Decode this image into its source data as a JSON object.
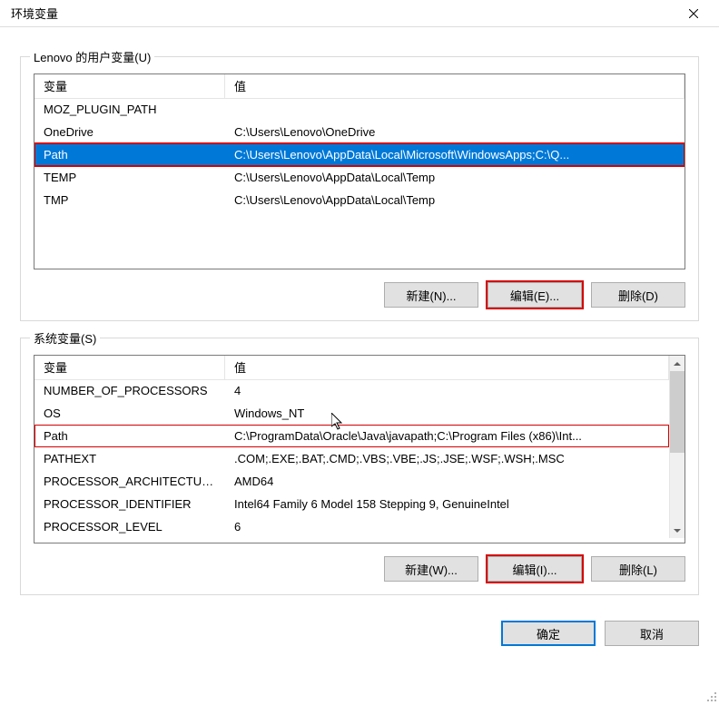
{
  "title": "环境变量",
  "userGroup": {
    "label": "Lenovo 的用户变量(U)",
    "headers": {
      "var": "变量",
      "val": "值"
    },
    "rows": [
      {
        "var": "MOZ_PLUGIN_PATH",
        "val": ""
      },
      {
        "var": "OneDrive",
        "val": "C:\\Users\\Lenovo\\OneDrive"
      },
      {
        "var": "Path",
        "val": "C:\\Users\\Lenovo\\AppData\\Local\\Microsoft\\WindowsApps;C:\\Q..."
      },
      {
        "var": "TEMP",
        "val": "C:\\Users\\Lenovo\\AppData\\Local\\Temp"
      },
      {
        "var": "TMP",
        "val": "C:\\Users\\Lenovo\\AppData\\Local\\Temp"
      }
    ],
    "buttons": {
      "new": "新建(N)...",
      "edit": "编辑(E)...",
      "del": "删除(D)"
    }
  },
  "sysGroup": {
    "label": "系统变量(S)",
    "headers": {
      "var": "变量",
      "val": "值"
    },
    "rows": [
      {
        "var": "NUMBER_OF_PROCESSORS",
        "val": "4"
      },
      {
        "var": "OS",
        "val": "Windows_NT"
      },
      {
        "var": "Path",
        "val": "C:\\ProgramData\\Oracle\\Java\\javapath;C:\\Program Files (x86)\\Int..."
      },
      {
        "var": "PATHEXT",
        "val": ".COM;.EXE;.BAT;.CMD;.VBS;.VBE;.JS;.JSE;.WSF;.WSH;.MSC"
      },
      {
        "var": "PROCESSOR_ARCHITECTURE",
        "val": "AMD64"
      },
      {
        "var": "PROCESSOR_IDENTIFIER",
        "val": "Intel64 Family 6 Model 158 Stepping 9, GenuineIntel"
      },
      {
        "var": "PROCESSOR_LEVEL",
        "val": "6"
      }
    ],
    "buttons": {
      "new": "新建(W)...",
      "edit": "编辑(I)...",
      "del": "删除(L)"
    }
  },
  "footer": {
    "ok": "确定",
    "cancel": "取消"
  },
  "highlight": {
    "userSelectedIndex": 2,
    "sysRedIndex": 2
  }
}
